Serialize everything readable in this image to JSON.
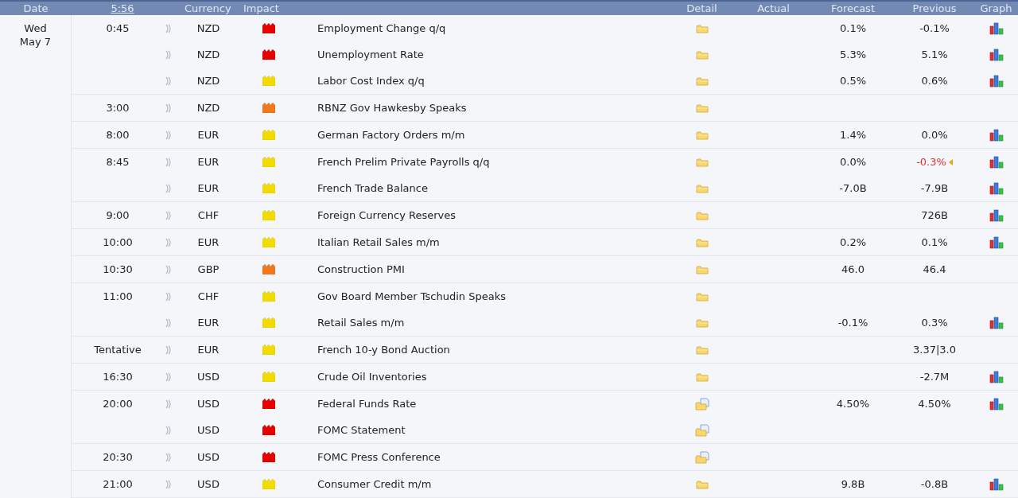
{
  "header": {
    "columns": [
      {
        "label": "Date",
        "kind": "plain"
      },
      {
        "label": "5:56",
        "kind": "link"
      },
      {
        "label": "Currency",
        "kind": "plain"
      },
      {
        "label": "Impact",
        "kind": "plain"
      },
      {
        "kind": "blank"
      },
      {
        "label": "Detail",
        "kind": "plain"
      },
      {
        "label": "Actual",
        "kind": "plain"
      },
      {
        "label": "Forecast",
        "kind": "plain"
      },
      {
        "label": "Previous",
        "kind": "plain"
      },
      {
        "label": "Graph",
        "kind": "plain"
      }
    ]
  },
  "day": {
    "weekday": "Wed",
    "date": "May 7"
  },
  "groups": [
    {
      "time": "0:45",
      "events": [
        {
          "currency": "NZD",
          "impact": {
            "kind": "high"
          },
          "event": "Employment Change q/q",
          "detail": {
            "kind": "folder"
          },
          "forecast": "0.1%",
          "previous": "-0.1%",
          "revised": false,
          "graph": true
        },
        {
          "currency": "NZD",
          "impact": {
            "kind": "high"
          },
          "event": "Unemployment Rate",
          "detail": {
            "kind": "folder"
          },
          "forecast": "5.3%",
          "previous": "5.1%",
          "revised": false,
          "graph": true
        },
        {
          "currency": "NZD",
          "impact": {
            "kind": "low"
          },
          "event": "Labor Cost Index q/q",
          "detail": {
            "kind": "folder"
          },
          "forecast": "0.5%",
          "previous": "0.6%",
          "revised": false,
          "graph": true
        }
      ]
    },
    {
      "time": "3:00",
      "events": [
        {
          "currency": "NZD",
          "impact": {
            "kind": "medium"
          },
          "event": "RBNZ Gov Hawkesby Speaks",
          "detail": {
            "kind": "folder"
          },
          "graph": false
        }
      ]
    },
    {
      "time": "8:00",
      "events": [
        {
          "currency": "EUR",
          "impact": {
            "kind": "low"
          },
          "event": "German Factory Orders m/m",
          "detail": {
            "kind": "folder"
          },
          "forecast": "1.4%",
          "previous": "0.0%",
          "revised": false,
          "graph": true
        }
      ]
    },
    {
      "time": "8:45",
      "events": [
        {
          "currency": "EUR",
          "impact": {
            "kind": "low"
          },
          "event": "French Prelim Private Payrolls q/q",
          "detail": {
            "kind": "folder"
          },
          "forecast": "0.0%",
          "previous": "-0.3%",
          "revised": true,
          "graph": true
        },
        {
          "currency": "EUR",
          "impact": {
            "kind": "low"
          },
          "event": "French Trade Balance",
          "detail": {
            "kind": "folder"
          },
          "forecast": "-7.0B",
          "previous": "-7.9B",
          "revised": false,
          "graph": true
        }
      ]
    },
    {
      "time": "9:00",
      "events": [
        {
          "currency": "CHF",
          "impact": {
            "kind": "low"
          },
          "event": "Foreign Currency Reserves",
          "detail": {
            "kind": "folder"
          },
          "previous": "726B",
          "revised": false,
          "graph": true
        }
      ]
    },
    {
      "time": "10:00",
      "events": [
        {
          "currency": "EUR",
          "impact": {
            "kind": "low"
          },
          "event": "Italian Retail Sales m/m",
          "detail": {
            "kind": "folder"
          },
          "forecast": "0.2%",
          "previous": "0.1%",
          "revised": false,
          "graph": true
        }
      ]
    },
    {
      "time": "10:30",
      "events": [
        {
          "currency": "GBP",
          "impact": {
            "kind": "medium"
          },
          "event": "Construction PMI",
          "detail": {
            "kind": "folder"
          },
          "forecast": "46.0",
          "previous": "46.4",
          "revised": false,
          "graph": false
        }
      ]
    },
    {
      "time": "11:00",
      "events": [
        {
          "currency": "CHF",
          "impact": {
            "kind": "low"
          },
          "event": "Gov Board Member Tschudin Speaks",
          "detail": {
            "kind": "folder"
          },
          "graph": false
        },
        {
          "currency": "EUR",
          "impact": {
            "kind": "low"
          },
          "event": "Retail Sales m/m",
          "detail": {
            "kind": "folder"
          },
          "forecast": "-0.1%",
          "previous": "0.3%",
          "revised": false,
          "graph": true
        }
      ]
    },
    {
      "time": "Tentative",
      "events": [
        {
          "currency": "EUR",
          "impact": {
            "kind": "low"
          },
          "event": "French 10-y Bond Auction",
          "detail": {
            "kind": "folder"
          },
          "previous": "3.37|3.0",
          "revised": false,
          "graph": false
        }
      ]
    },
    {
      "time": "16:30",
      "events": [
        {
          "currency": "USD",
          "impact": {
            "kind": "low"
          },
          "event": "Crude Oil Inventories",
          "detail": {
            "kind": "folder"
          },
          "previous": "-2.7M",
          "revised": false,
          "graph": true
        }
      ]
    },
    {
      "time": "20:00",
      "events": [
        {
          "currency": "USD",
          "impact": {
            "kind": "high"
          },
          "event": "Federal Funds Rate",
          "detail": {
            "kind": "folder-doc"
          },
          "forecast": "4.50%",
          "previous": "4.50%",
          "revised": false,
          "graph": true
        },
        {
          "currency": "USD",
          "impact": {
            "kind": "high"
          },
          "event": "FOMC Statement",
          "detail": {
            "kind": "folder-doc"
          },
          "graph": false
        }
      ]
    },
    {
      "time": "20:30",
      "events": [
        {
          "currency": "USD",
          "impact": {
            "kind": "high"
          },
          "event": "FOMC Press Conference",
          "detail": {
            "kind": "folder-doc"
          },
          "graph": false
        }
      ]
    },
    {
      "time": "21:00",
      "events": [
        {
          "currency": "USD",
          "impact": {
            "kind": "low"
          },
          "event": "Consumer Credit m/m",
          "detail": {
            "kind": "folder"
          },
          "forecast": "9.8B",
          "previous": "-0.8B",
          "revised": false,
          "graph": true
        }
      ]
    }
  ]
}
